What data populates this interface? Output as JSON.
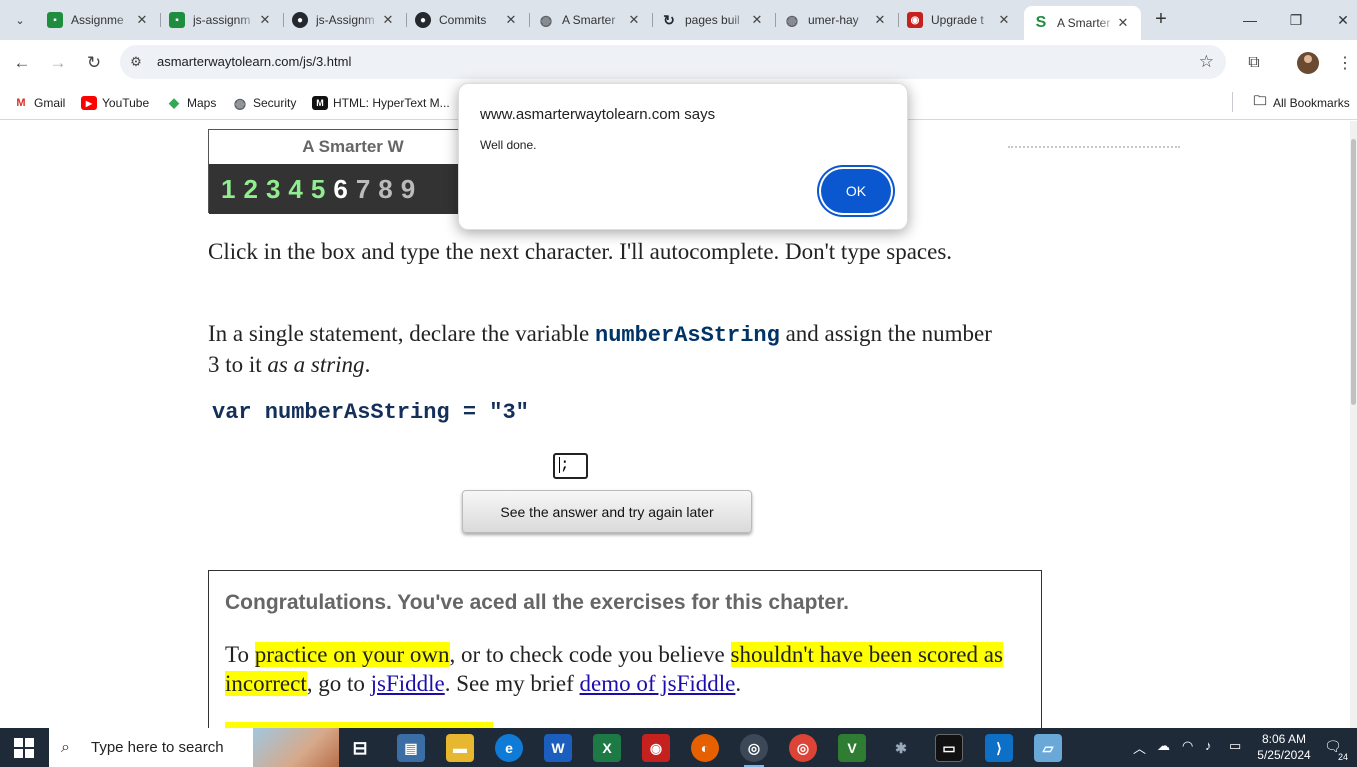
{
  "tabs": [
    {
      "title": "Assignme",
      "icon": "classroom-icon",
      "color": "#1e8e3e"
    },
    {
      "title": "js-assignm",
      "icon": "classroom-icon",
      "color": "#1e8e3e"
    },
    {
      "title": "js-Assignm",
      "icon": "github-icon",
      "color": "#24292f"
    },
    {
      "title": "Commits",
      "icon": "github-icon",
      "color": "#24292f"
    },
    {
      "title": "A Smarter",
      "icon": "globe-icon",
      "color": "#5f6368"
    },
    {
      "title": "pages buil",
      "icon": "github-actions-icon",
      "color": "#24292f"
    },
    {
      "title": "umer-hay",
      "icon": "globe-icon",
      "color": "#5f6368"
    },
    {
      "title": "Upgrade t",
      "icon": "screen-recorder-icon",
      "color": "#c5221f"
    },
    {
      "title": "A Smarter",
      "icon": "smarter-way-icon",
      "color": "#1e8e3e",
      "active": true
    }
  ],
  "toolbar": {
    "url": "asmarterwaytolearn.com/js/3.html"
  },
  "bookmarks": [
    {
      "label": "Gmail",
      "icon": "gmail-icon"
    },
    {
      "label": "YouTube",
      "icon": "youtube-icon"
    },
    {
      "label": "Maps",
      "icon": "maps-icon"
    },
    {
      "label": "Security",
      "icon": "globe-icon"
    },
    {
      "label": "HTML: HyperText M...",
      "icon": "mdn-icon"
    }
  ],
  "all_bookmarks_label": "All Bookmarks",
  "page": {
    "header_title": "A Smarter W",
    "chapter_numbers": [
      "1",
      "2",
      "3",
      "4",
      "5",
      "6",
      "7",
      "8",
      "9"
    ],
    "completed_color": "#90ee90",
    "current_color": "#ffffff",
    "pending_color": "#bbbbbb",
    "instruction1": "Click in the box and type the next character. I'll autocomplete. Don't type spaces.",
    "instruction2_pre": "In a single statement, declare the variable ",
    "instruction2_code": "numberAsString",
    "instruction2_mid": " and assign the number 3 to it ",
    "instruction2_em": "as a string",
    "instruction2_end": ".",
    "code_line": "var numberAsString = \"3\"",
    "answer_value": ";",
    "see_answer_button": "See the answer and try again later",
    "congrats_heading": "Congratulations. You've aced all the exercises for this chapter.",
    "para_1": "To ",
    "para_hl1": "practice on your own",
    "para_2": ", or to check code you believe ",
    "para_hl2": "shouldn't have been scored as incorrect",
    "para_3": ", go to ",
    "para_link1": "jsFiddle",
    "para_4": ". See my brief ",
    "para_link2": "demo of jsFiddle",
    "para_5": "."
  },
  "dialog": {
    "title": "www.asmarterwaytolearn.com says",
    "message": "Well done.",
    "ok_label": "OK"
  },
  "taskbar": {
    "search_placeholder": "Type here to search",
    "time": "8:06 AM",
    "date": "5/25/2024",
    "notification_count": "24"
  }
}
